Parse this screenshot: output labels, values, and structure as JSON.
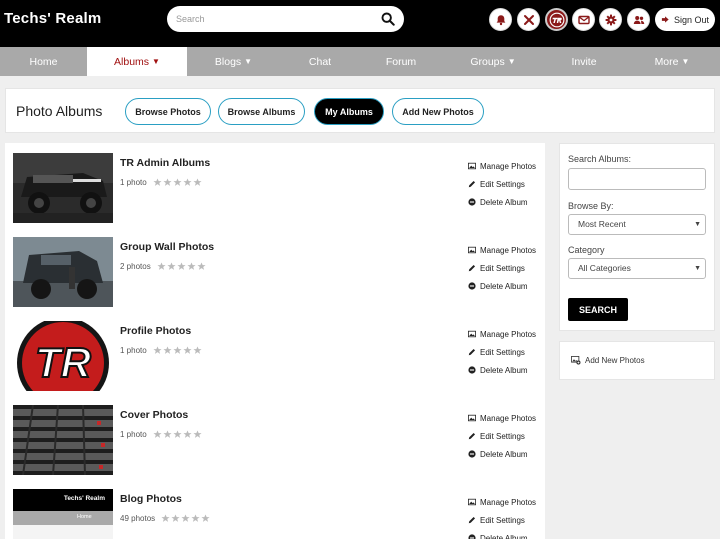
{
  "header": {
    "brand": "Techs' Realm",
    "search_placeholder": "Search",
    "signout_label": "Sign Out",
    "icons": [
      "bell-icon",
      "tools-icon",
      "profile-avatar",
      "mail-icon",
      "gear-icon",
      "users-icon"
    ]
  },
  "nav": {
    "items": [
      {
        "label": "Home",
        "caret": ""
      },
      {
        "label": "Albums",
        "caret": "▼"
      },
      {
        "label": "Blogs",
        "caret": "▼"
      },
      {
        "label": "Chat",
        "caret": ""
      },
      {
        "label": "Forum",
        "caret": ""
      },
      {
        "label": "Groups",
        "caret": "▼"
      },
      {
        "label": "Invite",
        "caret": ""
      },
      {
        "label": "More",
        "caret": "▼"
      }
    ]
  },
  "titlebar": {
    "title": "Photo Albums",
    "buttons": [
      "Browse Photos",
      "Browse Albums",
      "My Albums",
      "Add New Photos"
    ]
  },
  "albums": [
    {
      "name": "TR Admin Albums",
      "count": "1 photo"
    },
    {
      "name": "Group Wall Photos",
      "count": "2 photos"
    },
    {
      "name": "Profile Photos",
      "count": "1 photo"
    },
    {
      "name": "Cover Photos",
      "count": "1 photo"
    },
    {
      "name": "Blog Photos",
      "count": "49 photos"
    }
  ],
  "album_actions": {
    "manage": "Manage Photos",
    "edit": "Edit Settings",
    "delete": "Delete Album"
  },
  "blog_thumb": {
    "brand": "Techs' Realm",
    "nav": "Home"
  },
  "profile_thumb": {
    "logo_text": "TR"
  },
  "sidebar": {
    "search_label": "Search Albums:",
    "browse_label": "Browse By:",
    "browse_value": "Most Recent",
    "category_label": "Category",
    "category_value": "All Categories",
    "search_button": "SEARCH",
    "add_new_label": "Add New Photos"
  },
  "colors": {
    "accent": "#a01010",
    "button_border": "#2a9fc3",
    "nav_bg": "#a9a9a9"
  }
}
